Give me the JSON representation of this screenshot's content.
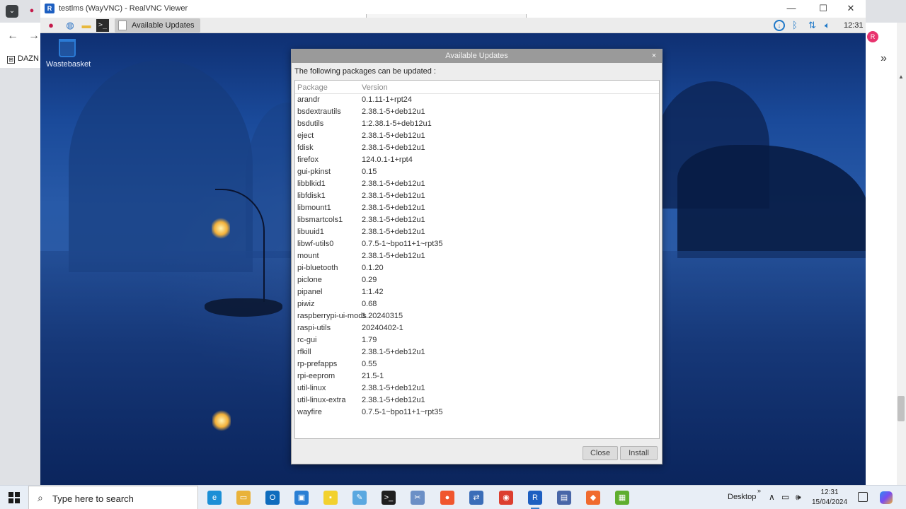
{
  "host": {
    "bookmark_label": "DAZN",
    "nav_back": "←",
    "nav_forward": "→",
    "avatar_letter": "R",
    "more_chevron": "»"
  },
  "vnc": {
    "title": "testlms (WayVNC) - RealVNC Viewer",
    "logo_text": "R",
    "minimize": "—",
    "maximize": "☐",
    "close": "✕"
  },
  "remote_panel": {
    "task_label": "Available Updates",
    "clock": "12:31",
    "icons": [
      "raspberry-menu-icon",
      "web-browser-icon",
      "file-manager-icon",
      "terminal-icon"
    ],
    "tray_icons": [
      "updates-icon",
      "bluetooth-icon",
      "network-icon",
      "volume-icon"
    ]
  },
  "desktop": {
    "wastebasket_label": "Wastebasket"
  },
  "dialog": {
    "title": "Available Updates",
    "close_glyph": "×",
    "message": "The following packages can be updated :",
    "columns": {
      "package": "Package",
      "version": "Version"
    },
    "packages": [
      {
        "name": "arandr",
        "version": "0.1.11-1+rpt24"
      },
      {
        "name": "bsdextrautils",
        "version": "2.38.1-5+deb12u1"
      },
      {
        "name": "bsdutils",
        "version": "1:2.38.1-5+deb12u1"
      },
      {
        "name": "eject",
        "version": "2.38.1-5+deb12u1"
      },
      {
        "name": "fdisk",
        "version": "2.38.1-5+deb12u1"
      },
      {
        "name": "firefox",
        "version": "124.0.1-1+rpt4"
      },
      {
        "name": "gui-pkinst",
        "version": "0.15"
      },
      {
        "name": "libblkid1",
        "version": "2.38.1-5+deb12u1"
      },
      {
        "name": "libfdisk1",
        "version": "2.38.1-5+deb12u1"
      },
      {
        "name": "libmount1",
        "version": "2.38.1-5+deb12u1"
      },
      {
        "name": "libsmartcols1",
        "version": "2.38.1-5+deb12u1"
      },
      {
        "name": "libuuid1",
        "version": "2.38.1-5+deb12u1"
      },
      {
        "name": "libwf-utils0",
        "version": "0.7.5-1~bpo11+1~rpt35"
      },
      {
        "name": "mount",
        "version": "2.38.1-5+deb12u1"
      },
      {
        "name": "pi-bluetooth",
        "version": "0.1.20"
      },
      {
        "name": "piclone",
        "version": "0.29"
      },
      {
        "name": "pipanel",
        "version": "1:1.42"
      },
      {
        "name": "piwiz",
        "version": "0.68"
      },
      {
        "name": "raspberrypi-ui-mods",
        "version": "1.20240315"
      },
      {
        "name": "raspi-utils",
        "version": "20240402-1"
      },
      {
        "name": "rc-gui",
        "version": "1.79"
      },
      {
        "name": "rfkill",
        "version": "2.38.1-5+deb12u1"
      },
      {
        "name": "rp-prefapps",
        "version": "0.55"
      },
      {
        "name": "rpi-eeprom",
        "version": "21.5-1"
      },
      {
        "name": "util-linux",
        "version": "2.38.1-5+deb12u1"
      },
      {
        "name": "util-linux-extra",
        "version": "2.38.1-5+deb12u1"
      },
      {
        "name": "wayfire",
        "version": "0.7.5-1~bpo11+1~rpt35"
      }
    ],
    "buttons": {
      "close": "Close",
      "install": "Install"
    }
  },
  "win_taskbar": {
    "search_placeholder": "Type here to search",
    "desktop_label": "Desktop",
    "time": "12:31",
    "date": "15/04/2024",
    "apps": [
      {
        "name": "edge-icon",
        "color": "#1b8fd6",
        "glyph": "e"
      },
      {
        "name": "file-explorer-icon",
        "color": "#e9b23a",
        "glyph": "▭"
      },
      {
        "name": "outlook-icon",
        "color": "#0f6cbd",
        "glyph": "O"
      },
      {
        "name": "remote-desktop-icon",
        "color": "#2a7fd4",
        "glyph": "▣"
      },
      {
        "name": "sticky-notes-icon",
        "color": "#f2d12e",
        "glyph": "▪"
      },
      {
        "name": "notepad-icon",
        "color": "#5aa8e0",
        "glyph": "✎"
      },
      {
        "name": "terminal-icon",
        "color": "#1f1f1f",
        "glyph": ">_"
      },
      {
        "name": "snipping-icon",
        "color": "#6b8fc6",
        "glyph": "✂"
      },
      {
        "name": "firefox-icon",
        "color": "#f0562e",
        "glyph": "●"
      },
      {
        "name": "network-tool-icon",
        "color": "#3a6db8",
        "glyph": "⇄"
      },
      {
        "name": "chrome-icon",
        "color": "#dc3e2f",
        "glyph": "◉"
      },
      {
        "name": "realvnc-icon",
        "color": "#1d5fc1",
        "glyph": "R"
      },
      {
        "name": "remote-admin-icon",
        "color": "#4866a8",
        "glyph": "▤"
      },
      {
        "name": "brave-icon",
        "color": "#f06a2e",
        "glyph": "◆"
      },
      {
        "name": "pixel-app-icon",
        "color": "#5fae2e",
        "glyph": "▦"
      }
    ],
    "tray_icons": [
      "chevron-up-icon",
      "network-icon",
      "speaker-icon"
    ]
  }
}
